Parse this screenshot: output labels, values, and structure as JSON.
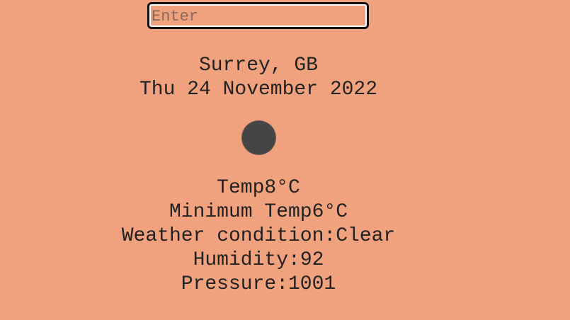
{
  "search": {
    "placeholder": "Enter",
    "value": ""
  },
  "location": {
    "city": "Surrey, GB",
    "date": "Thu 24 November 2022"
  },
  "weather": {
    "icon": "weather-condition-icon",
    "temp_label": "Temp",
    "temp_value": "8°C",
    "min_temp_label": "Minimum Temp",
    "min_temp_value": "6°C",
    "condition_label": "Weather condition:",
    "condition_value": "Clear",
    "humidity_label": "Humidity:",
    "humidity_value": "92",
    "pressure_label": "Pressure:",
    "pressure_value": "1001"
  },
  "colors": {
    "background": "#f0a27e",
    "text": "#222222",
    "icon": "#454545"
  }
}
